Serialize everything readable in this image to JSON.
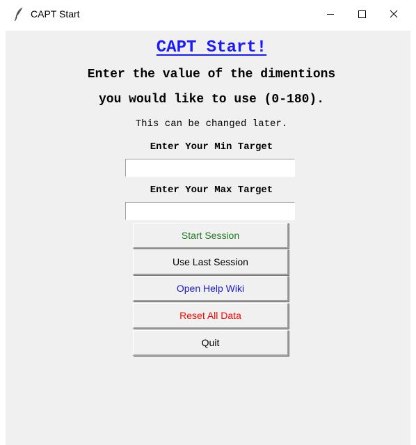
{
  "window": {
    "title": "CAPT Start"
  },
  "header": {
    "title": "CAPT Start!",
    "line1": "Enter the value of the dimentions",
    "line2": "you would like to use (0-180).",
    "note": "This can be changed later."
  },
  "form": {
    "min_label": "Enter Your Min Target",
    "min_value": "",
    "max_label": "Enter Your Max Target",
    "max_value": ""
  },
  "buttons": {
    "start": "Start Session",
    "last": "Use Last Session",
    "wiki": "Open Help Wiki",
    "reset": "Reset All Data",
    "quit": "Quit"
  },
  "colors": {
    "title": "#1a1aff",
    "start": "#1f7a1f",
    "wiki": "#1a1acc",
    "reset": "#ff0000",
    "background": "#f0f0f0"
  },
  "icons": {
    "app": "feather-icon",
    "minimize": "minimize-icon",
    "maximize": "maximize-icon",
    "close": "close-icon"
  }
}
